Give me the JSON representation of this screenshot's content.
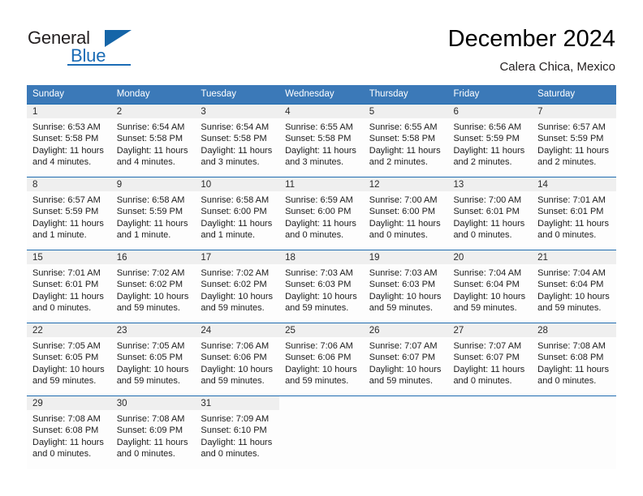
{
  "brand": {
    "name_part1": "General",
    "name_part2": "Blue",
    "logo_icon": "triangle-logo-icon",
    "accent_color": "#1b6cb5"
  },
  "header": {
    "month_title": "December 2024",
    "location": "Calera Chica, Mexico"
  },
  "colors": {
    "header_row_bg": "#3b79b8",
    "daynum_bg": "#efefef",
    "cell_border": "#1f6cb0",
    "text": "#1c1c1c"
  },
  "calendar": {
    "weekday_headers": [
      "Sunday",
      "Monday",
      "Tuesday",
      "Wednesday",
      "Thursday",
      "Friday",
      "Saturday"
    ],
    "labels": {
      "sunrise": "Sunrise:",
      "sunset": "Sunset:",
      "daylight": "Daylight:"
    },
    "weeks": [
      [
        {
          "day": "1",
          "sunrise": "Sunrise: 6:53 AM",
          "sunset": "Sunset: 5:58 PM",
          "daylight1": "Daylight: 11 hours",
          "daylight2": "and 4 minutes."
        },
        {
          "day": "2",
          "sunrise": "Sunrise: 6:54 AM",
          "sunset": "Sunset: 5:58 PM",
          "daylight1": "Daylight: 11 hours",
          "daylight2": "and 4 minutes."
        },
        {
          "day": "3",
          "sunrise": "Sunrise: 6:54 AM",
          "sunset": "Sunset: 5:58 PM",
          "daylight1": "Daylight: 11 hours",
          "daylight2": "and 3 minutes."
        },
        {
          "day": "4",
          "sunrise": "Sunrise: 6:55 AM",
          "sunset": "Sunset: 5:58 PM",
          "daylight1": "Daylight: 11 hours",
          "daylight2": "and 3 minutes."
        },
        {
          "day": "5",
          "sunrise": "Sunrise: 6:55 AM",
          "sunset": "Sunset: 5:58 PM",
          "daylight1": "Daylight: 11 hours",
          "daylight2": "and 2 minutes."
        },
        {
          "day": "6",
          "sunrise": "Sunrise: 6:56 AM",
          "sunset": "Sunset: 5:59 PM",
          "daylight1": "Daylight: 11 hours",
          "daylight2": "and 2 minutes."
        },
        {
          "day": "7",
          "sunrise": "Sunrise: 6:57 AM",
          "sunset": "Sunset: 5:59 PM",
          "daylight1": "Daylight: 11 hours",
          "daylight2": "and 2 minutes."
        }
      ],
      [
        {
          "day": "8",
          "sunrise": "Sunrise: 6:57 AM",
          "sunset": "Sunset: 5:59 PM",
          "daylight1": "Daylight: 11 hours",
          "daylight2": "and 1 minute."
        },
        {
          "day": "9",
          "sunrise": "Sunrise: 6:58 AM",
          "sunset": "Sunset: 5:59 PM",
          "daylight1": "Daylight: 11 hours",
          "daylight2": "and 1 minute."
        },
        {
          "day": "10",
          "sunrise": "Sunrise: 6:58 AM",
          "sunset": "Sunset: 6:00 PM",
          "daylight1": "Daylight: 11 hours",
          "daylight2": "and 1 minute."
        },
        {
          "day": "11",
          "sunrise": "Sunrise: 6:59 AM",
          "sunset": "Sunset: 6:00 PM",
          "daylight1": "Daylight: 11 hours",
          "daylight2": "and 0 minutes."
        },
        {
          "day": "12",
          "sunrise": "Sunrise: 7:00 AM",
          "sunset": "Sunset: 6:00 PM",
          "daylight1": "Daylight: 11 hours",
          "daylight2": "and 0 minutes."
        },
        {
          "day": "13",
          "sunrise": "Sunrise: 7:00 AM",
          "sunset": "Sunset: 6:01 PM",
          "daylight1": "Daylight: 11 hours",
          "daylight2": "and 0 minutes."
        },
        {
          "day": "14",
          "sunrise": "Sunrise: 7:01 AM",
          "sunset": "Sunset: 6:01 PM",
          "daylight1": "Daylight: 11 hours",
          "daylight2": "and 0 minutes."
        }
      ],
      [
        {
          "day": "15",
          "sunrise": "Sunrise: 7:01 AM",
          "sunset": "Sunset: 6:01 PM",
          "daylight1": "Daylight: 11 hours",
          "daylight2": "and 0 minutes."
        },
        {
          "day": "16",
          "sunrise": "Sunrise: 7:02 AM",
          "sunset": "Sunset: 6:02 PM",
          "daylight1": "Daylight: 10 hours",
          "daylight2": "and 59 minutes."
        },
        {
          "day": "17",
          "sunrise": "Sunrise: 7:02 AM",
          "sunset": "Sunset: 6:02 PM",
          "daylight1": "Daylight: 10 hours",
          "daylight2": "and 59 minutes."
        },
        {
          "day": "18",
          "sunrise": "Sunrise: 7:03 AM",
          "sunset": "Sunset: 6:03 PM",
          "daylight1": "Daylight: 10 hours",
          "daylight2": "and 59 minutes."
        },
        {
          "day": "19",
          "sunrise": "Sunrise: 7:03 AM",
          "sunset": "Sunset: 6:03 PM",
          "daylight1": "Daylight: 10 hours",
          "daylight2": "and 59 minutes."
        },
        {
          "day": "20",
          "sunrise": "Sunrise: 7:04 AM",
          "sunset": "Sunset: 6:04 PM",
          "daylight1": "Daylight: 10 hours",
          "daylight2": "and 59 minutes."
        },
        {
          "day": "21",
          "sunrise": "Sunrise: 7:04 AM",
          "sunset": "Sunset: 6:04 PM",
          "daylight1": "Daylight: 10 hours",
          "daylight2": "and 59 minutes."
        }
      ],
      [
        {
          "day": "22",
          "sunrise": "Sunrise: 7:05 AM",
          "sunset": "Sunset: 6:05 PM",
          "daylight1": "Daylight: 10 hours",
          "daylight2": "and 59 minutes."
        },
        {
          "day": "23",
          "sunrise": "Sunrise: 7:05 AM",
          "sunset": "Sunset: 6:05 PM",
          "daylight1": "Daylight: 10 hours",
          "daylight2": "and 59 minutes."
        },
        {
          "day": "24",
          "sunrise": "Sunrise: 7:06 AM",
          "sunset": "Sunset: 6:06 PM",
          "daylight1": "Daylight: 10 hours",
          "daylight2": "and 59 minutes."
        },
        {
          "day": "25",
          "sunrise": "Sunrise: 7:06 AM",
          "sunset": "Sunset: 6:06 PM",
          "daylight1": "Daylight: 10 hours",
          "daylight2": "and 59 minutes."
        },
        {
          "day": "26",
          "sunrise": "Sunrise: 7:07 AM",
          "sunset": "Sunset: 6:07 PM",
          "daylight1": "Daylight: 10 hours",
          "daylight2": "and 59 minutes."
        },
        {
          "day": "27",
          "sunrise": "Sunrise: 7:07 AM",
          "sunset": "Sunset: 6:07 PM",
          "daylight1": "Daylight: 11 hours",
          "daylight2": "and 0 minutes."
        },
        {
          "day": "28",
          "sunrise": "Sunrise: 7:08 AM",
          "sunset": "Sunset: 6:08 PM",
          "daylight1": "Daylight: 11 hours",
          "daylight2": "and 0 minutes."
        }
      ],
      [
        {
          "day": "29",
          "sunrise": "Sunrise: 7:08 AM",
          "sunset": "Sunset: 6:08 PM",
          "daylight1": "Daylight: 11 hours",
          "daylight2": "and 0 minutes."
        },
        {
          "day": "30",
          "sunrise": "Sunrise: 7:08 AM",
          "sunset": "Sunset: 6:09 PM",
          "daylight1": "Daylight: 11 hours",
          "daylight2": "and 0 minutes."
        },
        {
          "day": "31",
          "sunrise": "Sunrise: 7:09 AM",
          "sunset": "Sunset: 6:10 PM",
          "daylight1": "Daylight: 11 hours",
          "daylight2": "and 0 minutes."
        },
        null,
        null,
        null,
        null
      ]
    ]
  }
}
